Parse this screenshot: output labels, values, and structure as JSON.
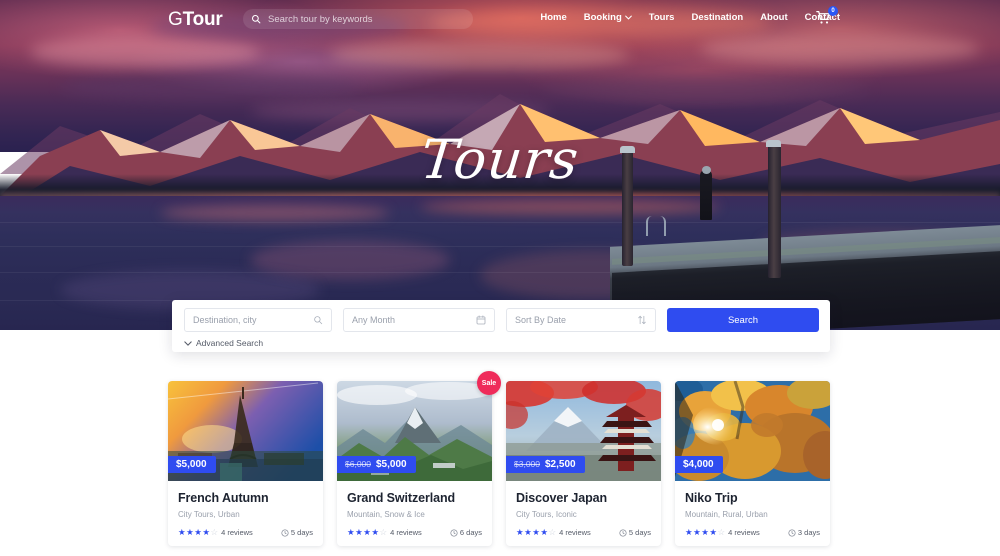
{
  "nav": {
    "logo_light": "G",
    "logo_bold": "Tour",
    "search_placeholder": "Search tour by keywords",
    "search_icon": "search-icon",
    "links": [
      {
        "label": "Home",
        "has_caret": false
      },
      {
        "label": "Booking",
        "has_caret": true
      },
      {
        "label": "Tours",
        "has_caret": false
      },
      {
        "label": "Destination",
        "has_caret": false
      },
      {
        "label": "About",
        "has_caret": false
      },
      {
        "label": "Contact",
        "has_caret": false
      }
    ],
    "cart": {
      "icon": "shopping-cart-icon",
      "badge_count": "0",
      "badge_color": "#2a56f5"
    }
  },
  "hero": {
    "title": "Tours"
  },
  "search_panel": {
    "destination": {
      "placeholder": "Destination, city",
      "icon": "magnifier-icon"
    },
    "month": {
      "placeholder": "Any Month",
      "icon": "calendar-icon"
    },
    "sort": {
      "placeholder": "Sort By Date",
      "icon": "sort-arrows-icon"
    },
    "search_button": "Search",
    "advanced_search": "Advanced Search",
    "advanced_icon": "chevron-down-icon",
    "accent_color": "#2f4cf0"
  },
  "cards": [
    {
      "title": "French Autumn",
      "tags": "City Tours, Urban",
      "price": "$5,000",
      "price_old": "",
      "sale": false,
      "stars_filled": 4,
      "stars_total": 5,
      "reviews": "4 reviews",
      "days": "5 days",
      "image_alt": "eiffel-tower-sunset"
    },
    {
      "title": "Grand Switzerland",
      "tags": "Mountain, Snow & Ice",
      "price": "$5,000",
      "price_old": "$6,000",
      "sale": true,
      "sale_label": "Sale",
      "stars_filled": 4,
      "stars_total": 5,
      "reviews": "4 reviews",
      "days": "6 days",
      "image_alt": "swiss-alps-green-mountain"
    },
    {
      "title": "Discover Japan",
      "tags": "City Tours, Iconic",
      "price": "$2,500",
      "price_old": "$3,000",
      "sale": false,
      "stars_filled": 4,
      "stars_total": 5,
      "reviews": "4 reviews",
      "days": "5 days",
      "image_alt": "mount-fuji-pagoda"
    },
    {
      "title": "Niko Trip",
      "tags": "Mountain, Rural, Urban",
      "price": "$4,000",
      "price_old": "",
      "sale": false,
      "stars_filled": 4,
      "stars_total": 5,
      "reviews": "4 reviews",
      "days": "3 days",
      "image_alt": "autumn-foliage-trees"
    }
  ]
}
